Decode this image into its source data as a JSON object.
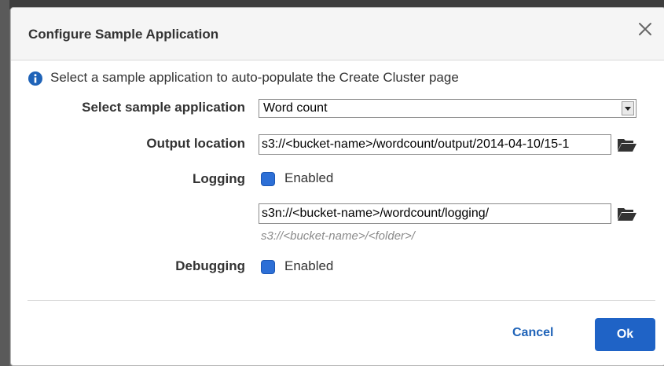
{
  "dialog": {
    "title": "Configure Sample Application",
    "info_text": "Select a sample application to auto-populate the Create Cluster page",
    "sample_application": {
      "label": "Select sample application",
      "selected": "Word count"
    },
    "output_location": {
      "label": "Output location",
      "value": "s3://<bucket-name>/wordcount/output/2014-04-10/15-1"
    },
    "logging": {
      "label": "Logging",
      "checkbox_label": "Enabled",
      "checked": true,
      "path_value": "s3n://<bucket-name>/wordcount/logging/",
      "hint": "s3://<bucket-name>/<folder>/"
    },
    "debugging": {
      "label": "Debugging",
      "checkbox_label": "Enabled",
      "checked": true
    },
    "buttons": {
      "cancel": "Cancel",
      "ok": "Ok"
    }
  },
  "colors": {
    "accent": "#1f63c6",
    "link": "#1f63b8",
    "checkbox": "#2d6fd6"
  }
}
